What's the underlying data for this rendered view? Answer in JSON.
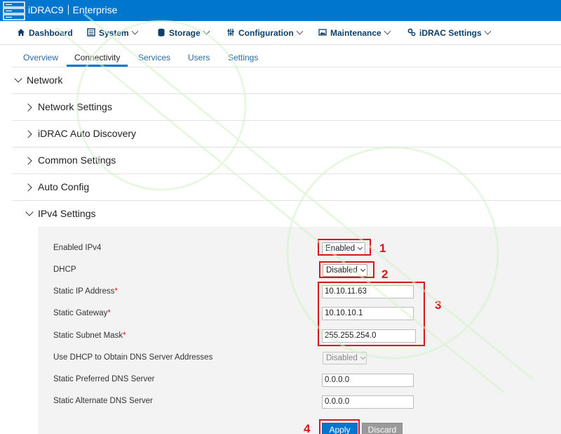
{
  "header": {
    "product": "iDRAC9",
    "edition": "Enterprise",
    "accent": "#0076ce"
  },
  "nav": {
    "items": [
      {
        "label": "Dashboard",
        "icon": "home-icon"
      },
      {
        "label": "System",
        "icon": "system-icon"
      },
      {
        "label": "Storage",
        "icon": "database-icon"
      },
      {
        "label": "Configuration",
        "icon": "sliders-icon"
      },
      {
        "label": "Maintenance",
        "icon": "image-icon"
      },
      {
        "label": "iDRAC Settings",
        "icon": "gears-icon"
      }
    ]
  },
  "tabs": {
    "items": [
      "Overview",
      "Connectivity",
      "Services",
      "Users",
      "Settings"
    ],
    "active": "Connectivity"
  },
  "tree": {
    "network": "Network",
    "network_settings": "Network Settings",
    "auto_discovery": "iDRAC Auto Discovery",
    "common_settings": "Common Settings",
    "auto_config": "Auto Config",
    "ipv4_settings": "IPv4 Settings"
  },
  "ipv4": {
    "enabled_label": "Enabled IPv4",
    "enabled_value": "Enabled",
    "dhcp_label": "DHCP",
    "dhcp_value": "Disabled",
    "static_ip_label": "Static IP Address",
    "static_ip_value": "10.10.11.63",
    "static_gw_label": "Static Gateway",
    "static_gw_value": "10.10.10.1",
    "static_mask_label": "Static Subnet Mask",
    "static_mask_value": "255.255.254.0",
    "dhcp_dns_label": "Use DHCP to Obtain DNS Server Addresses",
    "dhcp_dns_value": "Disabled",
    "pref_dns_label": "Static Preferred DNS Server",
    "pref_dns_value": "0.0.0.0",
    "alt_dns_label": "Static Alternate DNS Server",
    "alt_dns_value": "0.0.0.0",
    "required_mark": "*"
  },
  "buttons": {
    "apply": "Apply",
    "discard": "Discard"
  },
  "annotations": {
    "step1": "1",
    "step2": "2",
    "step3": "3",
    "step4": "4",
    "color": "#d9141b"
  }
}
